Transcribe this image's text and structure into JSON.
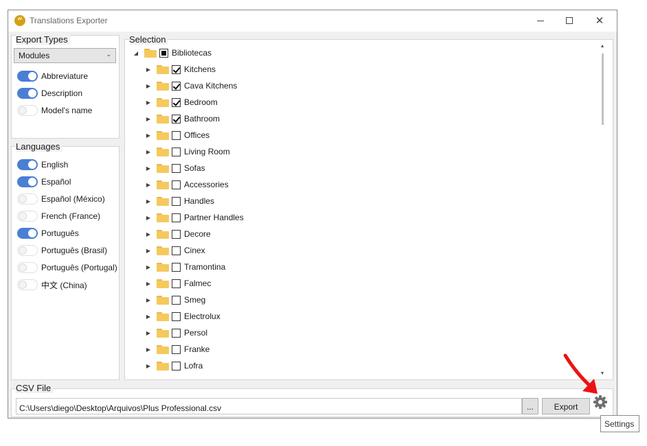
{
  "window": {
    "title": "Translations Exporter",
    "minimize_symbol": "—",
    "maximize_symbol": "☐",
    "close_symbol": "✕"
  },
  "export_types": {
    "label": "Export Types",
    "dropdown_value": "Modules",
    "toggles": [
      {
        "label": "Abbreviature",
        "on": true
      },
      {
        "label": "Description",
        "on": true
      },
      {
        "label": "Model's name",
        "on": false
      }
    ]
  },
  "languages": {
    "label": "Languages",
    "toggles": [
      {
        "label": "English",
        "on": true
      },
      {
        "label": "Español",
        "on": true
      },
      {
        "label": "Español (México)",
        "on": false
      },
      {
        "label": "French (France)",
        "on": false
      },
      {
        "label": "Português",
        "on": true
      },
      {
        "label": "Português (Brasil)",
        "on": false
      },
      {
        "label": "Português (Portugal)",
        "on": false
      },
      {
        "label": "中文 (China)",
        "on": false
      }
    ]
  },
  "selection": {
    "label": "Selection",
    "root": {
      "label": "Bibliotecas",
      "state": "partial"
    },
    "items": [
      {
        "label": "Kitchens",
        "checked": true
      },
      {
        "label": "Cava Kitchens",
        "checked": true
      },
      {
        "label": "Bedroom",
        "checked": true
      },
      {
        "label": "Bathroom",
        "checked": true
      },
      {
        "label": "Offices",
        "checked": false
      },
      {
        "label": "Living Room",
        "checked": false
      },
      {
        "label": "Sofas",
        "checked": false
      },
      {
        "label": "Accessories",
        "checked": false
      },
      {
        "label": "Handles",
        "checked": false
      },
      {
        "label": "Partner Handles",
        "checked": false
      },
      {
        "label": "Decore",
        "checked": false
      },
      {
        "label": "Cinex",
        "checked": false
      },
      {
        "label": "Tramontina",
        "checked": false
      },
      {
        "label": "Falmec",
        "checked": false
      },
      {
        "label": "Smeg",
        "checked": false
      },
      {
        "label": "Electrolux",
        "checked": false
      },
      {
        "label": "Persol",
        "checked": false
      },
      {
        "label": "Franke",
        "checked": false
      },
      {
        "label": "Lofra",
        "checked": false
      }
    ]
  },
  "csv": {
    "label": "CSV File",
    "path": "C:\\Users\\diego\\Desktop\\Arquivos\\Plus Professional.csv",
    "browse_label": "...",
    "export_label": "Export"
  },
  "tooltip": "Settings",
  "colors": {
    "toggle_on": "#4a7fd4",
    "annotation_arrow": "#ee1111",
    "folder": "#f5c95c"
  },
  "icons": {
    "settings": "gear-icon",
    "annotation": "red-arrow-icon"
  }
}
